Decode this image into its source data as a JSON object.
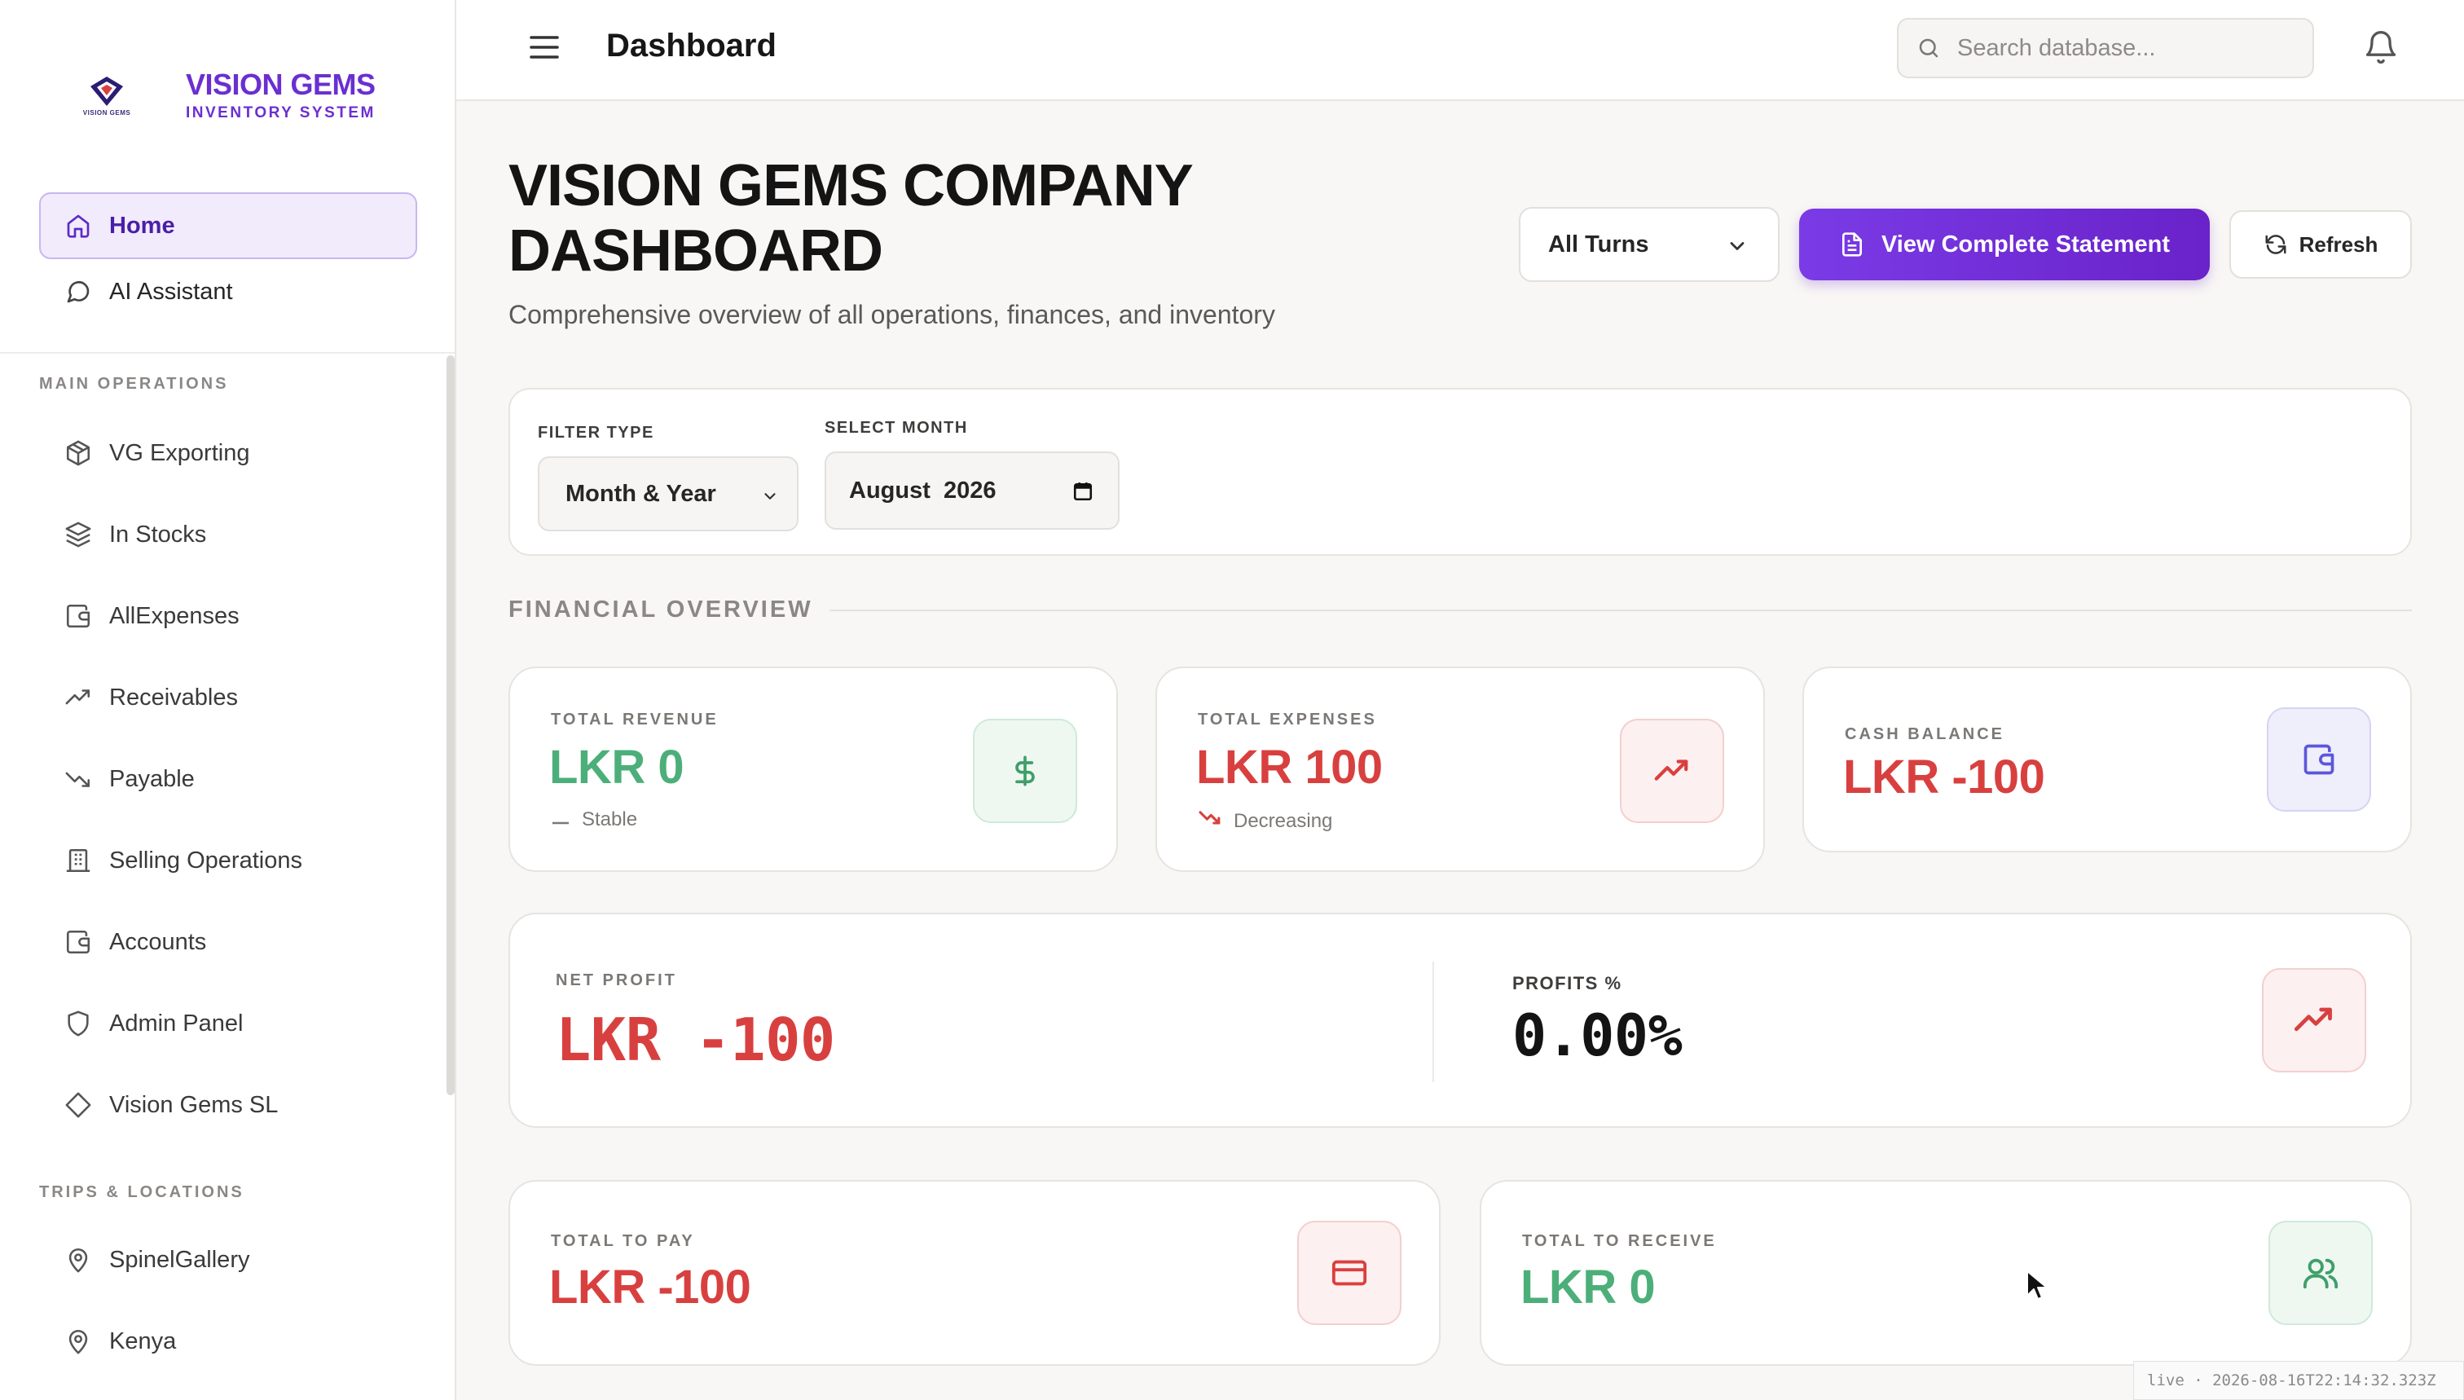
{
  "brand": {
    "title": "VISION GEMS",
    "subtitle": "INVENTORY SYSTEM",
    "logo_caption": "VISION GEMS"
  },
  "sidebar": {
    "top_items": [
      {
        "label": "Home",
        "icon": "home-icon",
        "active": true
      },
      {
        "label": "AI Assistant",
        "icon": "message-circle-icon"
      }
    ],
    "sections": [
      {
        "title": "MAIN OPERATIONS",
        "items": [
          {
            "label": "VG Exporting",
            "icon": "package-icon"
          },
          {
            "label": "In Stocks",
            "icon": "layers-icon"
          },
          {
            "label": "AllExpenses",
            "icon": "wallet-icon"
          },
          {
            "label": "Receivables",
            "icon": "trending-up-icon"
          },
          {
            "label": "Payable",
            "icon": "trending-down-icon"
          },
          {
            "label": "Selling Operations",
            "icon": "building-icon"
          },
          {
            "label": "Accounts",
            "icon": "wallet-icon"
          },
          {
            "label": "Admin Panel",
            "icon": "shield-icon"
          },
          {
            "label": "Vision Gems SL",
            "icon": "gem-icon"
          }
        ]
      },
      {
        "title": "TRIPS & LOCATIONS",
        "items": [
          {
            "label": "SpinelGallery",
            "icon": "map-pin-icon"
          },
          {
            "label": "Kenya",
            "icon": "map-pin-icon"
          }
        ]
      }
    ]
  },
  "header": {
    "title": "Dashboard",
    "search_placeholder": "Search database..."
  },
  "main": {
    "title": "VISION GEMS COMPANY DASHBOARD",
    "subtitle": "Comprehensive overview of all operations, finances, and inventory",
    "turns_select": "All Turns",
    "primary_button": "View Complete Statement",
    "refresh_button": "Refresh"
  },
  "filters": {
    "filter_type_label": "FILTER TYPE",
    "filter_type_value": "Month & Year",
    "month_label": "SELECT MONTH",
    "month_value": "August  2026"
  },
  "financial": {
    "section_title": "FINANCIAL OVERVIEW",
    "total_revenue": {
      "label": "TOTAL REVENUE",
      "value": "LKR 0",
      "trend": "Stable",
      "color": "#4caf7a"
    },
    "total_expenses": {
      "label": "TOTAL EXPENSES",
      "value": "LKR 100",
      "trend": "Decreasing",
      "color": "#d8403f"
    },
    "cash_balance": {
      "label": "CASH BALANCE",
      "value": "LKR -100",
      "color": "#d8403f"
    },
    "net_profit": {
      "label": "NET PROFIT",
      "value": "LKR -100"
    },
    "profits_pct": {
      "label": "PROFITS %",
      "value": "0.00%"
    },
    "total_to_pay": {
      "label": "TOTAL TO PAY",
      "value": "LKR -100"
    },
    "total_to_receive": {
      "label": "TOTAL TO RECEIVE",
      "value": "LKR 0"
    }
  },
  "live_badge": "live · 2026-08-16T22:14:32.323Z"
}
